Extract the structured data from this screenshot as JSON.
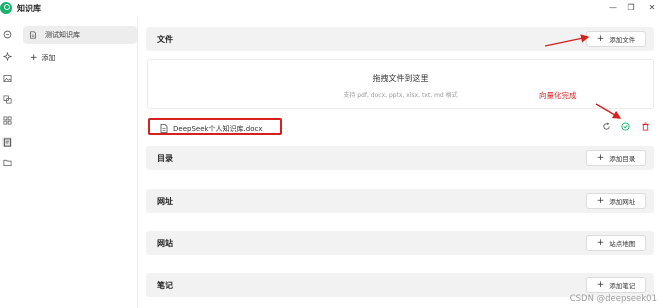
{
  "window": {
    "title": "知识库",
    "min_glyph": "—",
    "restore_glyph": "❐",
    "close_glyph": "✕"
  },
  "rail": {
    "icons": [
      "chat-icon",
      "sparkle-icon",
      "image-icon",
      "translate-icon",
      "grid-icon",
      "knowledge-base-icon",
      "folder-icon"
    ],
    "active": "knowledge-base-icon"
  },
  "kb_list": {
    "items": [
      {
        "label": "测试知识库"
      }
    ],
    "add_label": "添加"
  },
  "sections": {
    "files": {
      "title": "文件",
      "button": "添加文件"
    },
    "directory": {
      "title": "目录",
      "button": "添加目录"
    },
    "url": {
      "title": "网址",
      "button": "添加网址"
    },
    "website": {
      "title": "网站",
      "button": "站点地图"
    },
    "notes": {
      "title": "笔记",
      "button": "添加笔记"
    }
  },
  "dropzone": {
    "title": "拖拽文件到这里",
    "hint": "支持 pdf, docx, pptx, xlsx, txt, md 格式"
  },
  "file_item": {
    "name": "DeepSeek个人知识库.docx",
    "status": "vectorized-complete"
  },
  "annotation": {
    "text": "向量化完成",
    "color": "#d62020"
  },
  "colors": {
    "accent_green": "#17b36b",
    "annotation_red": "#d62020",
    "section_bg": "#f2f2f2"
  },
  "watermark": "CSDN @deepseek01"
}
